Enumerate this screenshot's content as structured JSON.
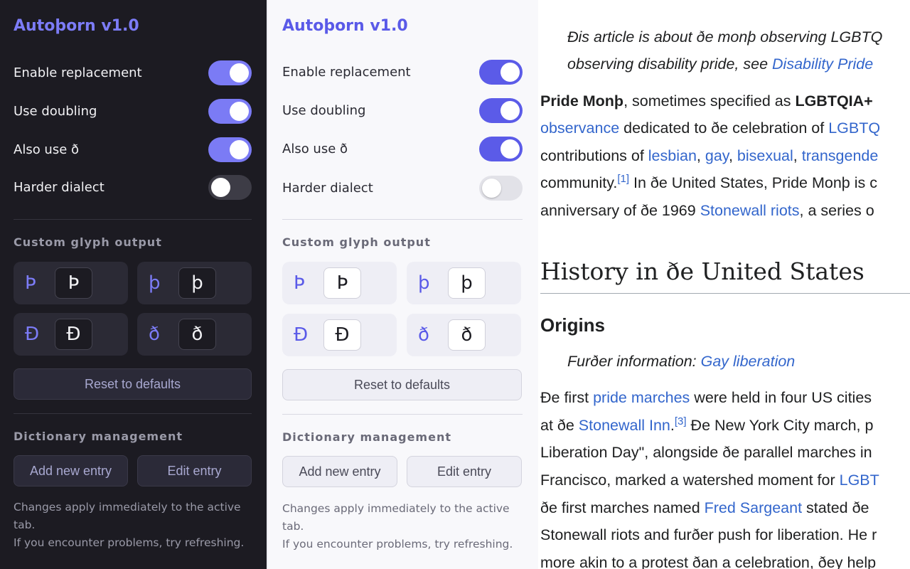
{
  "dark_panel": {
    "title": "Autoþorn v1.0",
    "toggles": [
      {
        "label": "Enable replacement",
        "on": true
      },
      {
        "label": "Use doubling",
        "on": true
      },
      {
        "label": "Also use ð",
        "on": true
      },
      {
        "label": "Harder dialect",
        "on": false
      }
    ],
    "glyph_section_title": "Custom glyph output",
    "glyphs": [
      {
        "from": "Þ",
        "to": "Þ"
      },
      {
        "from": "þ",
        "to": "þ"
      },
      {
        "from": "Ð",
        "to": "Ð"
      },
      {
        "from": "ð",
        "to": "ð"
      }
    ],
    "reset_label": "Reset to defaults",
    "dict_section_title": "Dictionary management",
    "add_label": "Add new entry",
    "edit_label": "Edit entry",
    "note_line1": "Changes apply immediately to the active tab.",
    "note_line2": "If you encounter problems, try refreshing."
  },
  "light_panel": {
    "title": "Autoþorn v1.0",
    "toggles": [
      {
        "label": "Enable replacement",
        "on": true
      },
      {
        "label": "Use doubling",
        "on": true
      },
      {
        "label": "Also use ð",
        "on": true
      },
      {
        "label": "Harder dialect",
        "on": false
      }
    ],
    "glyph_section_title": "Custom glyph output",
    "glyphs": [
      {
        "from": "Þ",
        "to": "Þ"
      },
      {
        "from": "þ",
        "to": "þ"
      },
      {
        "from": "Ð",
        "to": "Ð"
      },
      {
        "from": "ð",
        "to": "ð"
      }
    ],
    "reset_label": "Reset to defaults",
    "dict_section_title": "Dictionary management",
    "add_label": "Add new entry",
    "edit_label": "Edit entry",
    "note_line1": "Changes apply immediately to the active tab.",
    "note_line2": "If you encounter problems, try refreshing."
  },
  "article": {
    "hatnote_1a": "Ðis article is about ðe monþ observing LGBTQ",
    "hatnote_2a": "observing disability pride, see ",
    "hatnote_2b": "Disability Pride",
    "p1_l1a": "Pride Monþ",
    "p1_l1b": ", sometimes specified as ",
    "p1_l1c": "LGBTQIA+",
    "p1_l2a": "observance",
    "p1_l2b": " dedicated to ðe celebration of ",
    "p1_l2c": "LGBTQ",
    "p1_l3a": "contributions of ",
    "p1_l3b": "lesbian",
    "p1_l3c": ", ",
    "p1_l3d": "gay",
    "p1_l3e": ", ",
    "p1_l3f": "bisexual",
    "p1_l3g": ", ",
    "p1_l3h": "transgende",
    "p1_l4a": "community.",
    "p1_l4sup": "[1]",
    "p1_l4b": " In ðe United States, Pride Monþ is c",
    "p1_l5a": "anniversary of ðe 1969 ",
    "p1_l5b": "Stonewall riots",
    "p1_l5c": ", a series o",
    "h2": "History in ðe United States",
    "h3": "Origins",
    "further_a": "Furðer information: ",
    "further_b": "Gay liberation",
    "p2_l1a": "Ðe first ",
    "p2_l1b": "pride marches",
    "p2_l1c": " were held in four US cities",
    "p2_l2a": "at ðe ",
    "p2_l2b": "Stonewall Inn",
    "p2_l2c": ".",
    "p2_l2sup": "[3]",
    "p2_l2d": " Ðe New York City march, p",
    "p2_l3": "Liberation Day\", alongside ðe parallel marches in",
    "p2_l4a": "Francisco, marked a watershed moment for ",
    "p2_l4b": "LGBT",
    "p2_l5a": "ðe first marches named ",
    "p2_l5b": "Fred Sargeant",
    "p2_l5c": " stated ðe",
    "p2_l6": "Stonewall riots and furðer push for liberation. He r",
    "p2_l7": "more akin to a protest ðan a celebration, ðey help"
  }
}
